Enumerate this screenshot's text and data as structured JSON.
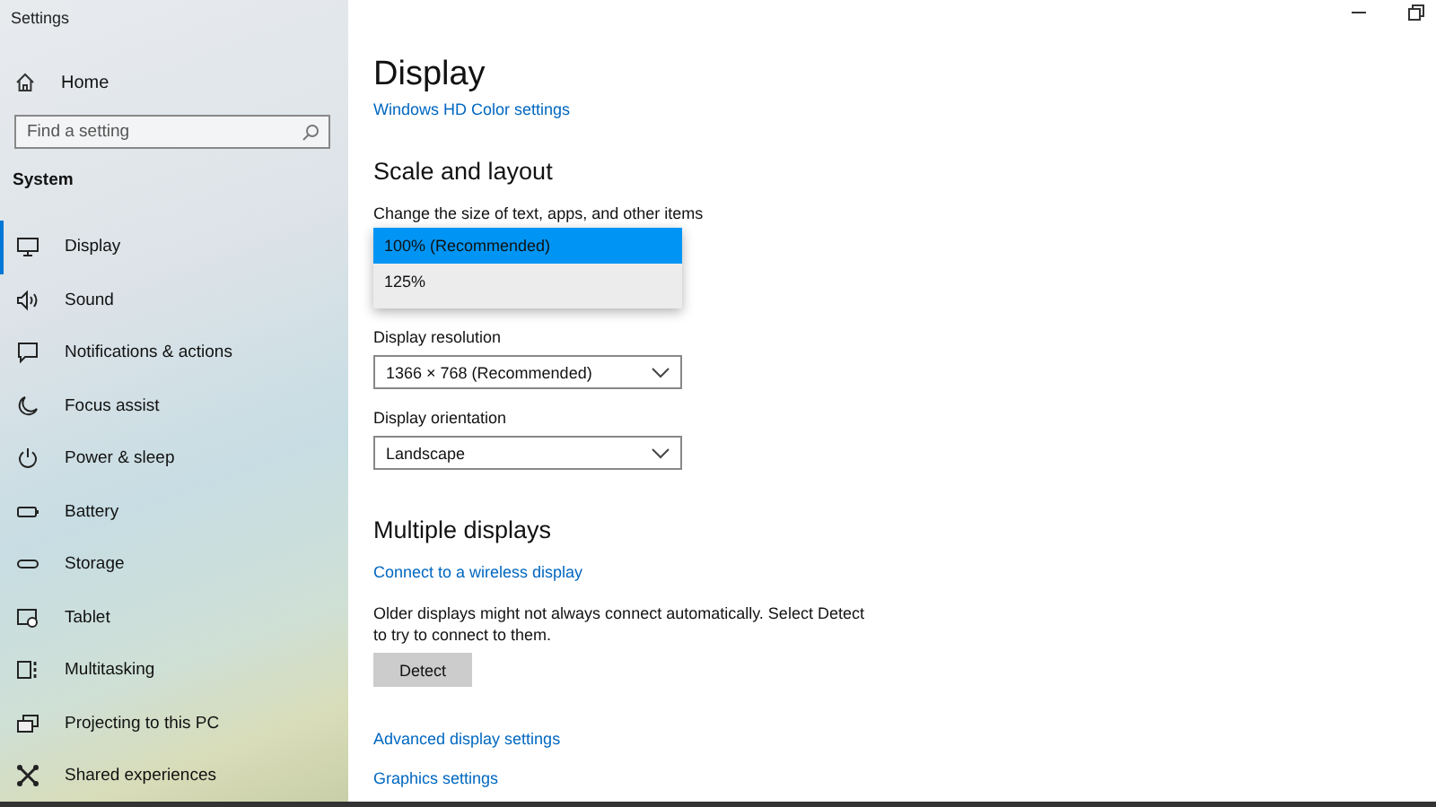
{
  "window": {
    "title": "Settings"
  },
  "sidebar": {
    "home": "Home",
    "search": {
      "placeholder": "Find a setting"
    },
    "section": "System",
    "items": [
      {
        "label": "Display",
        "selected": true
      },
      {
        "label": "Sound",
        "selected": false
      },
      {
        "label": "Notifications & actions",
        "selected": false
      },
      {
        "label": "Focus assist",
        "selected": false
      },
      {
        "label": "Power & sleep",
        "selected": false
      },
      {
        "label": "Battery",
        "selected": false
      },
      {
        "label": "Storage",
        "selected": false
      },
      {
        "label": "Tablet",
        "selected": false
      },
      {
        "label": "Multitasking",
        "selected": false
      },
      {
        "label": "Projecting to this PC",
        "selected": false
      },
      {
        "label": "Shared experiences",
        "selected": false
      }
    ]
  },
  "main": {
    "title": "Display",
    "hd_link": "Windows HD Color settings",
    "scale_section": "Scale and layout",
    "scale_label": "Change the size of text, apps, and other items",
    "scale_options": [
      {
        "label": "100% (Recommended)",
        "selected": true
      },
      {
        "label": "125%",
        "selected": false
      }
    ],
    "resolution_label": "Display resolution",
    "resolution_value": "1366 × 768 (Recommended)",
    "orientation_label": "Display orientation",
    "orientation_value": "Landscape",
    "multi_section": "Multiple displays",
    "wireless_link": "Connect to a wireless display",
    "detect_note": "Older displays might not always connect automatically. Select Detect to try to connect to them.",
    "detect_button": "Detect",
    "links": [
      "Advanced display settings",
      "Graphics settings"
    ]
  }
}
